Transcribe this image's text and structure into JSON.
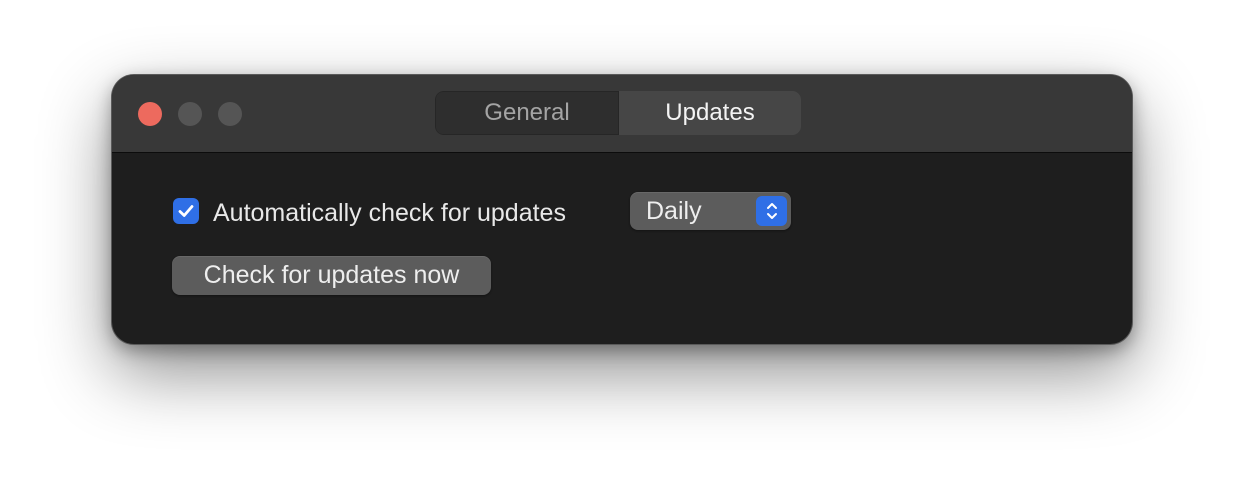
{
  "window": {
    "traffic_lights": [
      "close",
      "minimize",
      "zoom"
    ]
  },
  "toolbar": {
    "tabs": [
      {
        "label": "General",
        "selected": false
      },
      {
        "label": "Updates",
        "selected": true
      }
    ]
  },
  "updates": {
    "auto_check": {
      "label": "Automatically check for updates",
      "checked": true,
      "icon": "checkmark-icon"
    },
    "frequency": {
      "selected": "Daily",
      "icon": "chevron-up-down-icon"
    },
    "check_now_label": "Check for updates now"
  },
  "colors": {
    "accent": "#2f6fe6",
    "close_button": "#ed6a5e",
    "window_background": "#1e1e1e",
    "titlebar_background": "#383838",
    "button_background": "#5c5c5c"
  }
}
